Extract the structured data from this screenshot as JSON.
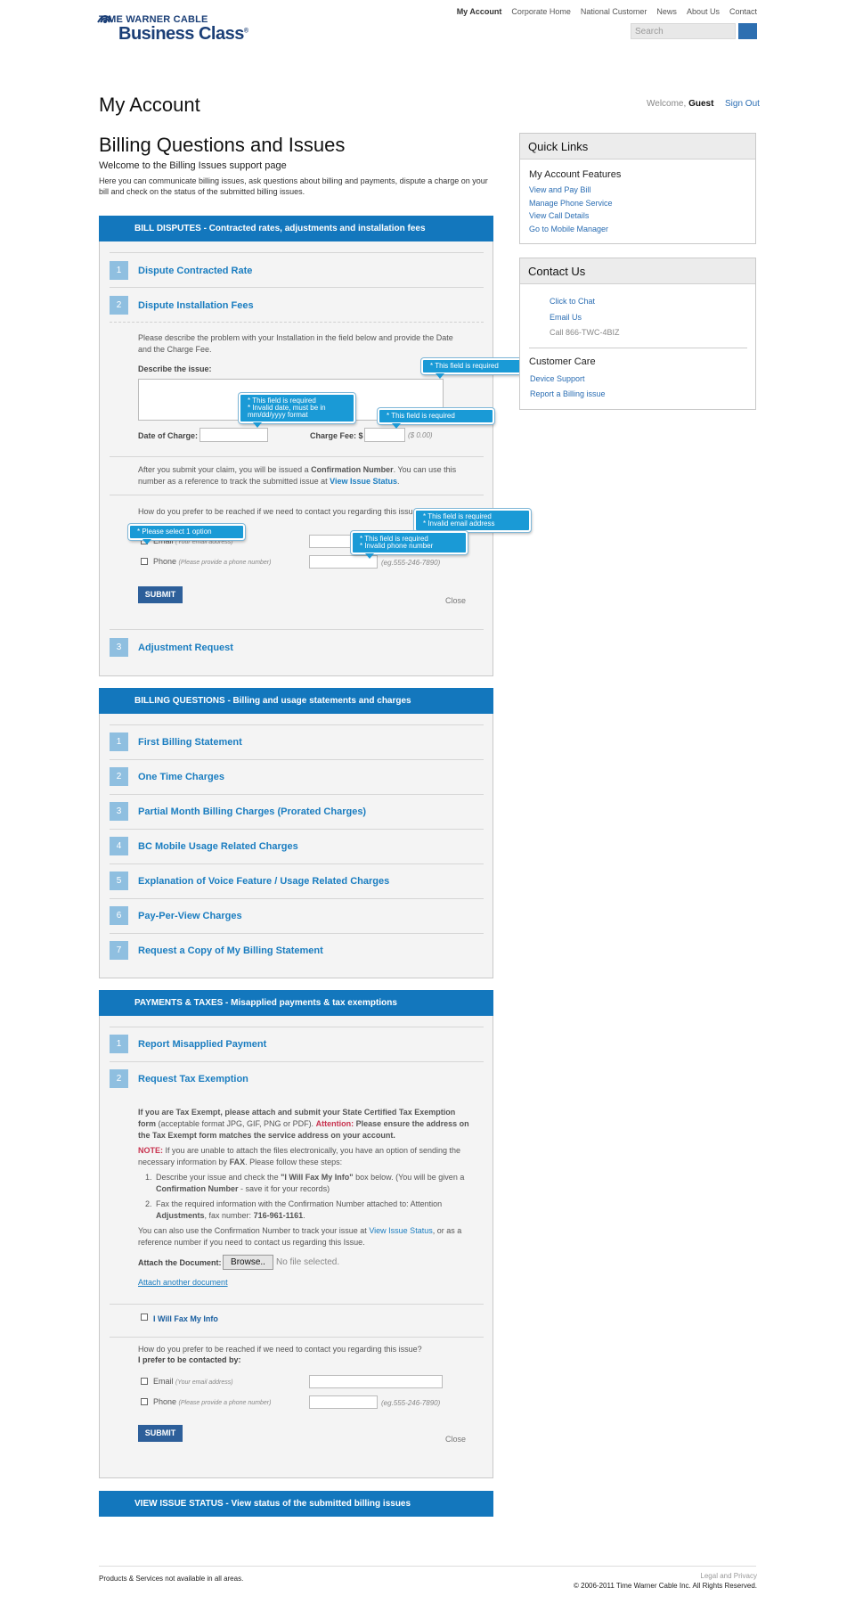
{
  "header": {
    "logo_line1": "TIME WARNER CABLE",
    "logo_line2": "Business Class",
    "nav": [
      "My Account",
      "Corporate Home",
      "National Customer",
      "News",
      "About Us",
      "Contact"
    ],
    "search_placeholder": "Search"
  },
  "account": {
    "title": "My Account",
    "welcome_prefix": "Welcome,",
    "user": "Guest",
    "signout": "Sign Out"
  },
  "intro": {
    "title": "Billing Questions and Issues",
    "subtitle": "Welcome to the Billing Issues support page",
    "description": "Here you can communicate billing issues, ask questions about billing and payments, dispute a charge on your bill and check on the status of the submitted billing issues."
  },
  "disputes": {
    "header": "BILL DISPUTES - Contracted rates, adjustments and installation fees",
    "items": [
      "Dispute Contracted Rate",
      "Dispute Installation Fees",
      "Adjustment Request"
    ],
    "numbers": [
      "1",
      "2",
      "3"
    ],
    "form": {
      "instructions": "Please describe the problem with your Installation in the field below and provide the Date and the Charge Fee.",
      "describe_label": "Describe the issue:",
      "date_label": "Date of Charge:",
      "fee_label": "Charge Fee: $",
      "fee_hint": "($ 0.00)",
      "after_text_1": "After you submit your claim, you will be issued a",
      "after_bold": "Confirmation Number",
      "after_text_2": ". You can use this number as a reference to track the submitted issue at",
      "view_status": "View Issue Status",
      "contact_question": "How do you prefer to be reached if we need to contact you regarding this issue?",
      "email_label": "Email",
      "email_hint": "(Your email address)",
      "phone_label": "Phone",
      "phone_hint": "(Please provide a phone number)",
      "phone_example": "(eg.555-246-7890)",
      "submit": "SUBMIT",
      "close": "Close"
    },
    "tooltips": {
      "describe": "* This field is required",
      "date_1": "* This field is required",
      "date_2": "* Invalid date, must be in mm/dd/yyyy format",
      "fee": "* This field is required",
      "select": "* Please select 1 option",
      "email_1": "* This field is required",
      "email_2": "* Invalid email address",
      "phone_1": "* This field is required",
      "phone_2": "* Invalid phone number"
    }
  },
  "questions": {
    "header": "BILLING QUESTIONS - Billing and usage statements and charges",
    "numbers": [
      "1",
      "2",
      "3",
      "4",
      "5",
      "6",
      "7"
    ],
    "items": [
      "First Billing Statement",
      "One Time Charges",
      "Partial Month Billing Charges (Prorated Charges)",
      "BC Mobile Usage Related Charges",
      "Explanation of Voice Feature / Usage Related Charges",
      "Pay-Per-View Charges",
      "Request a Copy of My Billing Statement"
    ]
  },
  "payments": {
    "header": "PAYMENTS & TAXES - Misapplied payments & tax exemptions",
    "numbers": [
      "1",
      "2"
    ],
    "items": [
      "Report Misapplied Payment",
      "Request Tax Exemption"
    ],
    "tax": {
      "p1_bold": "If you are Tax Exempt, please attach and submit your State Certified Tax Exemption form",
      "p1_normal": "(acceptable format JPG, GIF, PNG or PDF).",
      "p1_attention": "Attention:",
      "p1_bold2": "Please ensure the address on the Tax Exempt form matches the service address on your account.",
      "note_label": "NOTE:",
      "note_text": "If you are unable to attach the files electronically, you have an option of sending the necessary information by",
      "note_fax": "FAX",
      "note_end": ". Please follow these steps:",
      "step1_a": "Describe your issue and check the",
      "step1_b": "\"I Will Fax My Info\"",
      "step1_c": "box below. (You will be given a",
      "step1_d": "Confirmation Number",
      "step1_e": "- save it for your records)",
      "step2_a": "Fax the required information with the Confirmation Number attached to: Attention",
      "step2_b": "Adjustments",
      "step2_c": ", fax number:",
      "step2_d": "716-961-1161",
      "track_a": "You can also use the Confirmation Number to track your issue at",
      "track_link": "View Issue Status",
      "track_b": ", or as a reference number if you need to contact us regarding this Issue.",
      "attach_label": "Attach the Document:",
      "browse": "Browse..",
      "no_file": "No file selected.",
      "attach_another": "Attach another document",
      "fax_label": "I Will Fax My Info",
      "contact_question": "How do you prefer to be reached if we need to contact you regarding this issue?",
      "prefer": "I prefer to be contacted by:",
      "email_label": "Email",
      "email_hint": "(Your email address)",
      "phone_label": "Phone",
      "phone_hint": "(Please provide a phone number)",
      "phone_example": "(eg.555-246-7890)",
      "submit": "SUBMIT",
      "close": "Close"
    }
  },
  "status_header": "VIEW ISSUE STATUS - View status of the submitted billing issues",
  "sidebar": {
    "quick_title": "Quick Links",
    "features_title": "My Account Features",
    "features": [
      "View and Pay Bill",
      "Manage Phone Service",
      "View Call Details",
      "Go to Mobile Manager"
    ],
    "contact_title": "Contact Us",
    "contact": [
      "Click to Chat",
      "Email Us"
    ],
    "phone": "Call 866-TWC-4BIZ",
    "care_title": "Customer Care",
    "care": [
      "Device Support",
      "Report a Billing issue"
    ]
  },
  "footer": {
    "left": "Products & Services not available in all areas.",
    "legal": "Legal and Privacy",
    "copyright": "© 2006-2011 Time Warner Cable Inc. All Rights Reserved."
  },
  "colors": {
    "brand_blue": "#1377bd",
    "link_blue": "#2a6db3",
    "tooltip_blue": "#1a9ad6",
    "number_badge": "#8fbfe0"
  }
}
